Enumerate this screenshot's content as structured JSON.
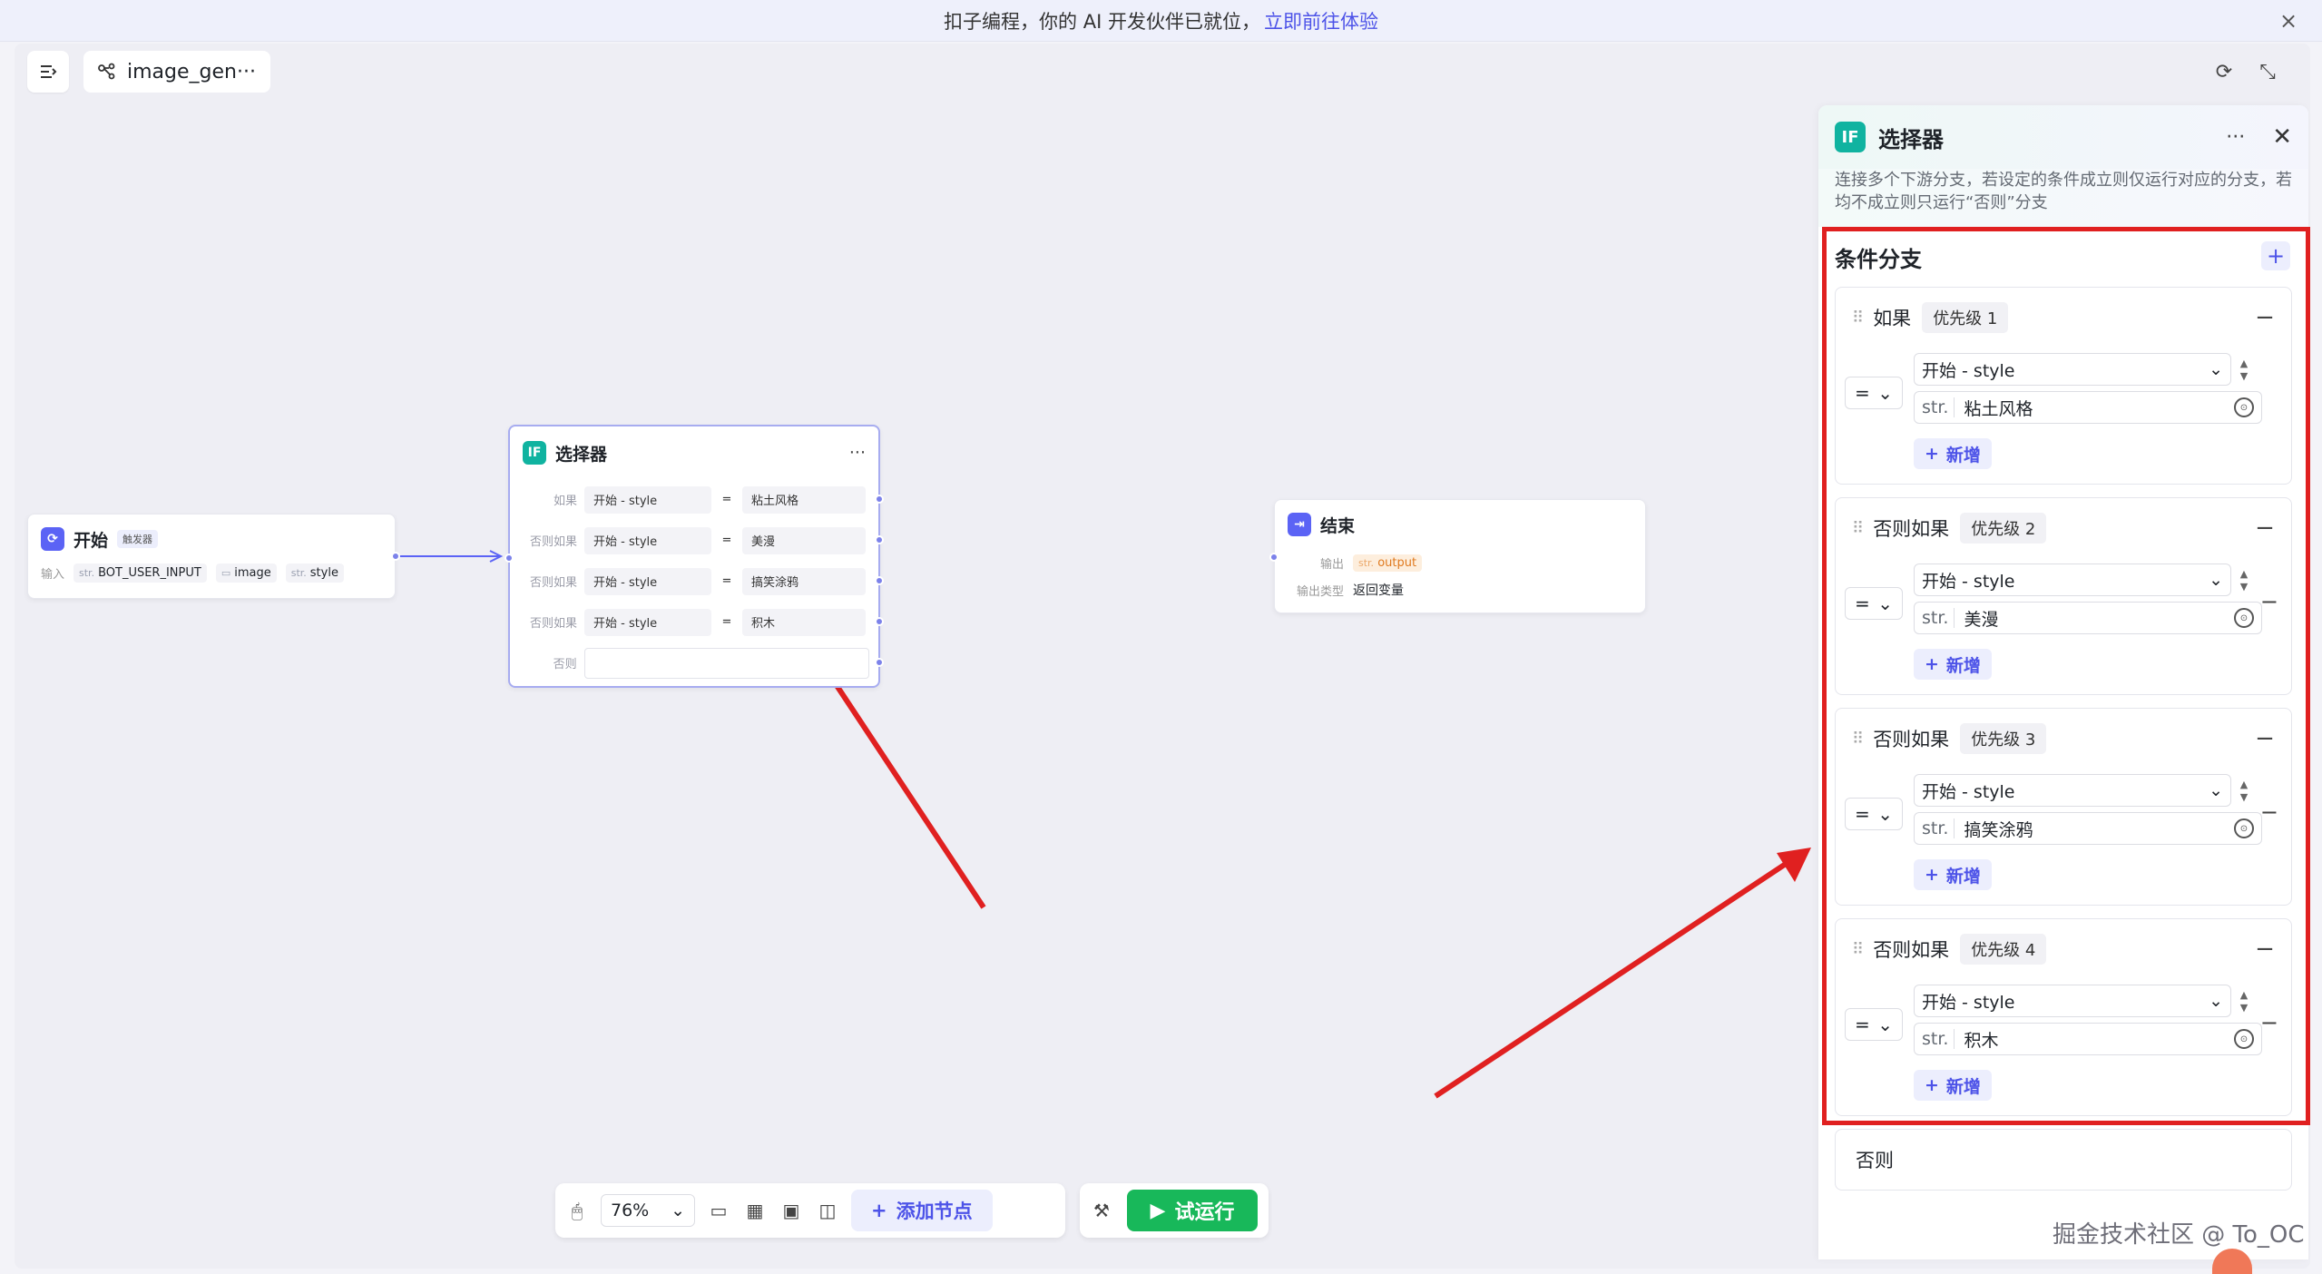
{
  "banner": {
    "text": "扣子编程，你的 AI 开发伙伴已就位，",
    "link": "立即前往体验"
  },
  "header": {
    "workflow_title": "image_gen···"
  },
  "nodes": {
    "start": {
      "title": "开始",
      "tag": "触发器",
      "input_label": "输入",
      "inputs": [
        {
          "type": "str.",
          "name": "BOT_USER_INPUT"
        },
        {
          "type": "img",
          "name": "image"
        },
        {
          "type": "str.",
          "name": "style"
        }
      ]
    },
    "selector": {
      "title": "选择器",
      "more": "···",
      "rows": [
        {
          "kw": "如果",
          "lhs": "开始  -  style",
          "op": "=",
          "rhs": "粘土风格"
        },
        {
          "kw": "否则如果",
          "lhs": "开始  -  style",
          "op": "=",
          "rhs": "美漫"
        },
        {
          "kw": "否则如果",
          "lhs": "开始  -  style",
          "op": "=",
          "rhs": "搞笑涂鸦"
        },
        {
          "kw": "否则如果",
          "lhs": "开始  -  style",
          "op": "=",
          "rhs": "积木"
        }
      ],
      "else_kw": "否则"
    },
    "end": {
      "title": "结束",
      "output_label": "输出",
      "output_prefix": "str.",
      "output_var": "output",
      "output_type_label": "输出类型",
      "output_type_value": "返回变量"
    }
  },
  "toolbar": {
    "zoom": "76%",
    "add_node": "添加节点",
    "run": "试运行"
  },
  "panel": {
    "title": "选择器",
    "more": "···",
    "description": "连接多个下游分支，若设定的条件成立则仅运行对应的分支，若均不成立则只运行“否则”分支",
    "section_title": "条件分支",
    "branches": [
      {
        "kw": "如果",
        "priority": "优先级 1",
        "op": "=",
        "var": "开始 - style",
        "val_type": "str.",
        "value": "粘土风格",
        "add": "新增"
      },
      {
        "kw": "否则如果",
        "priority": "优先级 2",
        "op": "=",
        "var": "开始 - style",
        "val_type": "str.",
        "value": "美漫",
        "add": "新增"
      },
      {
        "kw": "否则如果",
        "priority": "优先级 3",
        "op": "=",
        "var": "开始 - style",
        "val_type": "str.",
        "value": "搞笑涂鸦",
        "add": "新增"
      },
      {
        "kw": "否则如果",
        "priority": "优先级 4",
        "op": "=",
        "var": "开始 - style",
        "val_type": "str.",
        "value": "积木",
        "add": "新增"
      }
    ],
    "else_label": "否则"
  },
  "watermark": "掘金技术社区 @ To_OC",
  "colors": {
    "accent": "#4d53e8",
    "run_green": "#18b85a",
    "annotation_red": "#e02020",
    "selector_teal": "#10b3a0"
  }
}
